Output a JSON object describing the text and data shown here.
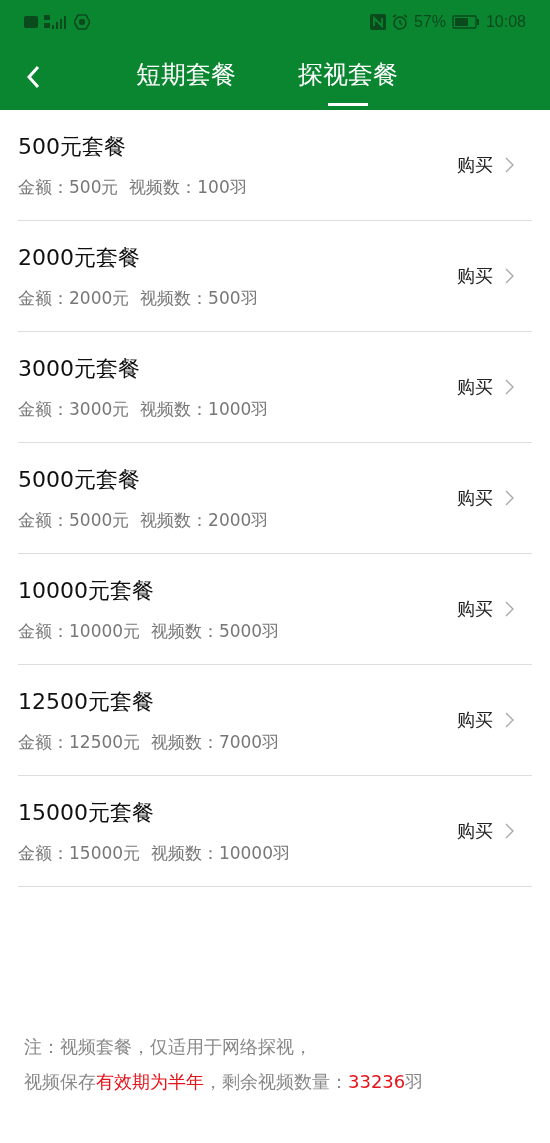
{
  "status_bar": {
    "battery": "57%",
    "time": "10:08"
  },
  "tabs": [
    {
      "label": "短期套餐",
      "selected": false
    },
    {
      "label": "探视套餐",
      "selected": true
    }
  ],
  "packages": [
    {
      "title": "500元套餐",
      "detail": "金额：500元  视频数：100羽",
      "action": "购买"
    },
    {
      "title": "2000元套餐",
      "detail": "金额：2000元  视频数：500羽",
      "action": "购买"
    },
    {
      "title": "3000元套餐",
      "detail": "金额：3000元  视频数：1000羽",
      "action": "购买"
    },
    {
      "title": "5000元套餐",
      "detail": "金额：5000元  视频数：2000羽",
      "action": "购买"
    },
    {
      "title": "10000元套餐",
      "detail": "金额：10000元  视频数：5000羽",
      "action": "购买"
    },
    {
      "title": "12500元套餐",
      "detail": "金额：12500元  视频数：7000羽",
      "action": "购买"
    },
    {
      "title": "15000元套餐",
      "detail": "金额：15000元  视频数：10000羽",
      "action": "购买"
    }
  ],
  "note": {
    "line_1": "注：视频套餐，仅适用于网络探视，",
    "line_2": [
      {
        "text": "视频保存",
        "highlight": false
      },
      {
        "text": "有效期为半年",
        "highlight": true
      },
      {
        "text": "，剩余视频数量：",
        "highlight": false
      },
      {
        "text": "33236",
        "highlight": true
      },
      {
        "text": "羽",
        "highlight": false
      }
    ]
  }
}
